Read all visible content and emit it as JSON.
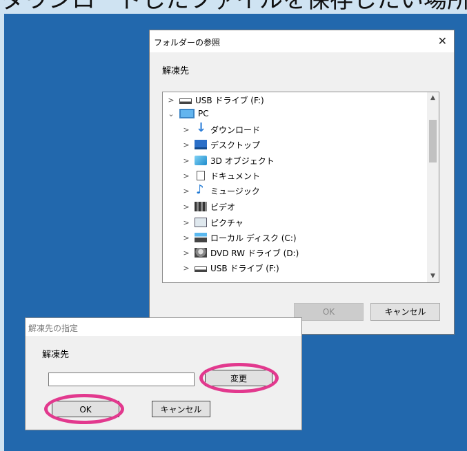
{
  "banner": {
    "text": "ダウンロードしたファイルを保存したい場所を選ぶ"
  },
  "browse_dialog": {
    "title": "フォルダーの参照",
    "close_glyph": "✕",
    "caption": "解凍先",
    "tree": [
      {
        "label": "USB ドライブ (F:)",
        "icon": "usb-drive-icon",
        "chevron": ">"
      },
      {
        "label": "PC",
        "icon": "pc-icon",
        "chevron": "⌄"
      },
      {
        "label": "ダウンロード",
        "icon": "download-icon",
        "chevron": ">"
      },
      {
        "label": "デスクトップ",
        "icon": "desktop-icon",
        "chevron": ">"
      },
      {
        "label": "3D オブジェクト",
        "icon": "3d-objects-icon",
        "chevron": ">"
      },
      {
        "label": "ドキュメント",
        "icon": "document-icon",
        "chevron": ">"
      },
      {
        "label": "ミュージック",
        "icon": "music-icon",
        "chevron": ">"
      },
      {
        "label": "ビデオ",
        "icon": "video-icon",
        "chevron": ">"
      },
      {
        "label": "ピクチャ",
        "icon": "pictures-icon",
        "chevron": ">"
      },
      {
        "label": "ローカル ディスク (C:)",
        "icon": "local-disk-icon",
        "chevron": ">"
      },
      {
        "label": "DVD RW ドライブ (D:)",
        "icon": "dvd-drive-icon",
        "chevron": ">"
      },
      {
        "label": "USB ドライブ (F:)",
        "icon": "usb-drive-icon",
        "chevron": ">"
      }
    ],
    "scroll_up": "▲",
    "scroll_down": "▼",
    "ok_label": "OK",
    "cancel_label": "キャンセル"
  },
  "extract_dialog": {
    "title": "解凍先の指定",
    "label": "解凍先",
    "path_value": "",
    "change_label": "変更",
    "ok_label": "OK",
    "cancel_label": "キャンセル"
  },
  "colors": {
    "desktop": "#2268ad",
    "highlight": "#e2398e",
    "banner_bg": "#cfe3f2"
  }
}
